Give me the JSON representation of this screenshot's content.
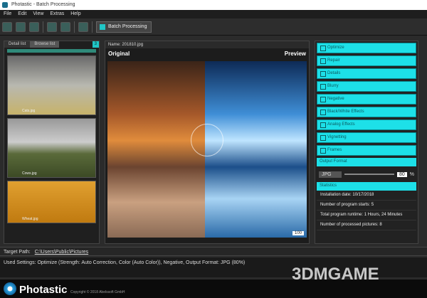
{
  "window": {
    "title": "Photastic - Batch Processing"
  },
  "menu": [
    "File",
    "Edit",
    "View",
    "Extras",
    "Help"
  ],
  "toolbar": {
    "batch_label": "Batch Processing"
  },
  "left": {
    "tabs": [
      "Detail list",
      "Browse list"
    ],
    "count": "3",
    "thumbs": [
      "Cats.jpg",
      "Cows.jpg",
      "Wheat.jpg"
    ]
  },
  "center": {
    "filename": "Name: 201810.jpg",
    "original": "Original",
    "preview": "Preview",
    "zoom": "100"
  },
  "right": {
    "sections": [
      "Optimize",
      "Repair",
      "Details",
      "Blurry",
      "Negative",
      "Black/White Effects",
      "Analog Effects",
      "Vignetting",
      "Frames"
    ],
    "output_format": "Output Format",
    "format": "JPG",
    "quality": "80",
    "pct": "%",
    "statistics": "Statistics",
    "stats": [
      "Installation date: 10/17/2018",
      "Number of program starts: 5",
      "Total program runtime: 1 Hours, 24 Minutes",
      "Number of processed pictures: 8"
    ]
  },
  "target": {
    "label": "Target Path:",
    "path": "C:\\Users\\Public\\Pictures"
  },
  "used_settings": "Used Settings: Optimize (Strength: Auto Correction, Color (Auto Color)), Negative, Output Format: JPG (80%)",
  "footer": {
    "brand": "Photastic",
    "copyright": "Copyright © 2018 Abelssoft GmbH"
  },
  "watermark": "3DMGAME"
}
